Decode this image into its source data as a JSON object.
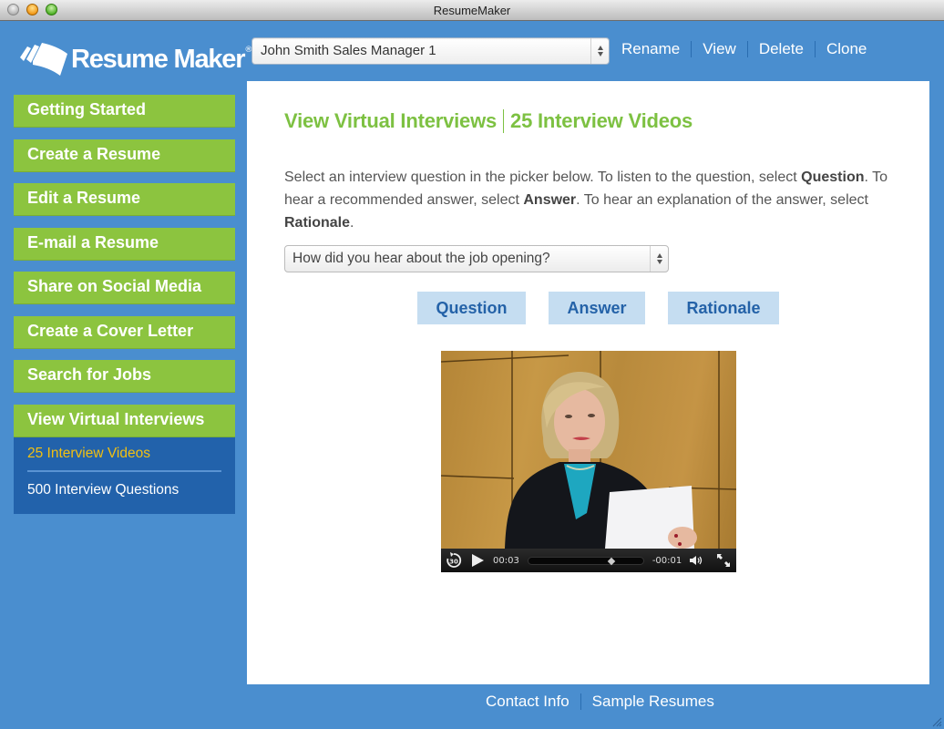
{
  "window": {
    "title": "ResumeMaker"
  },
  "header": {
    "logo_text": "Resume Maker",
    "logo_mark": "®",
    "resume_select": {
      "selected": "John Smith Sales Manager 1"
    },
    "actions": [
      {
        "label": "Rename"
      },
      {
        "label": "View"
      },
      {
        "label": "Delete"
      },
      {
        "label": "Clone"
      }
    ]
  },
  "sidebar": {
    "items": [
      {
        "label": "Getting Started"
      },
      {
        "label": "Create a Resume"
      },
      {
        "label": "Edit a Resume"
      },
      {
        "label": "E-mail a Resume"
      },
      {
        "label": "Share on Social Media"
      },
      {
        "label": "Create a Cover Letter"
      },
      {
        "label": "Search for Jobs"
      },
      {
        "label": "View Virtual Interviews",
        "active": true
      }
    ],
    "subitems": [
      {
        "label": "25 Interview Videos",
        "current": true
      },
      {
        "label": "500 Interview Questions",
        "current": false
      }
    ]
  },
  "main": {
    "title_section": "View Virtual Interviews",
    "title_page": "25 Interview Videos",
    "instructions": {
      "part1": "Select an interview question in the picker below. To listen to the question, select ",
      "bold1": "Question",
      "part2": ". To hear a recommended answer, select ",
      "bold2": "Answer",
      "part3": ". To hear an explanation of the answer, select ",
      "bold3": "Rationale",
      "part4": "."
    },
    "question_select": {
      "selected": "How did you hear about the job opening?"
    },
    "buttons": {
      "question": "Question",
      "answer": "Answer",
      "rationale": "Rationale"
    },
    "video": {
      "elapsed": "00:03",
      "remaining": "-00:01",
      "progress": 0.75,
      "skip_back_label": "30"
    }
  },
  "footer": {
    "links": [
      {
        "label": "Contact Info"
      },
      {
        "label": "Sample Resumes"
      }
    ]
  },
  "colors": {
    "background_blue": "#4a8ecf",
    "nav_green": "#8cc43f",
    "subnav_blue": "#2262ab",
    "current_sub_yellow": "#f2c011",
    "title_green": "#7dc142",
    "button_bg": "#c5ddf1",
    "button_text": "#2462a8"
  }
}
